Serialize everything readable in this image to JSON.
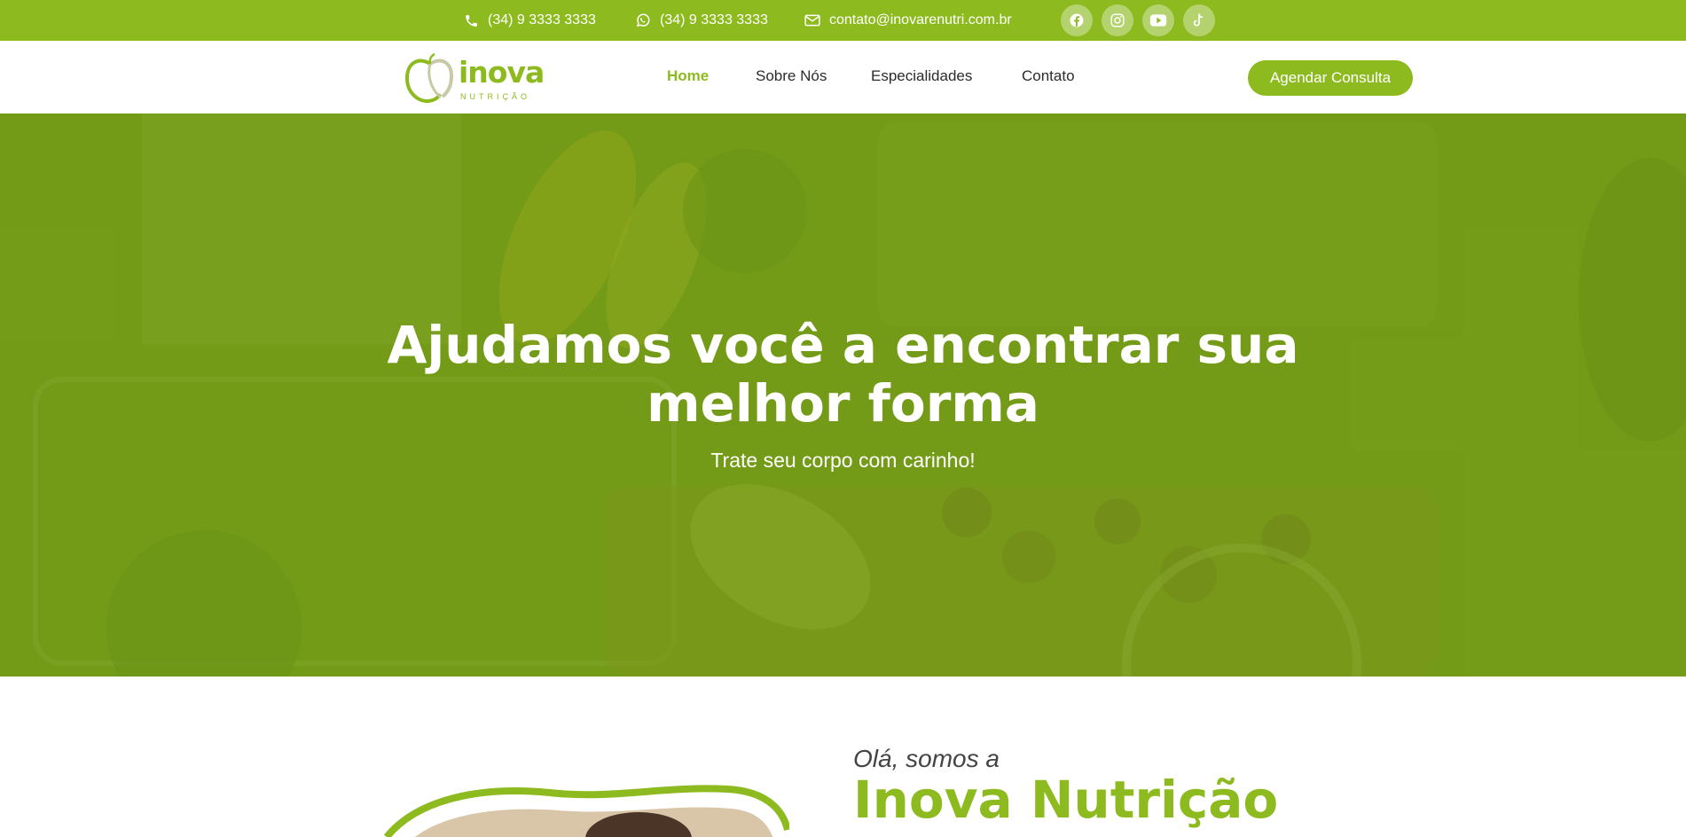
{
  "topbar": {
    "phone": "(34) 9 3333 3333",
    "whatsapp": "(34) 9 3333 3333",
    "email": "contato@inovarenutri.com.br",
    "social_icons": [
      "facebook-icon",
      "instagram-icon",
      "youtube-icon",
      "tiktok-icon"
    ]
  },
  "header": {
    "logo_text": "inova",
    "logo_sub": "NUTRIÇÃO",
    "nav": [
      {
        "label": "Home",
        "active": true
      },
      {
        "label": "Sobre Nós",
        "active": false
      },
      {
        "label": "Especialidades",
        "active": false
      },
      {
        "label": "Contato",
        "active": false
      }
    ],
    "cta_label": "Agendar Consulta"
  },
  "hero": {
    "title": "Ajudamos você a encontrar sua melhor forma",
    "subtitle": "Trate seu corpo com carinho!"
  },
  "about": {
    "greeting": "Olá, somos a",
    "title": "Inova Nutrição"
  },
  "colors": {
    "brand_green": "#8dbb1f",
    "white": "#ffffff",
    "dark_text": "#2b2b2b"
  }
}
